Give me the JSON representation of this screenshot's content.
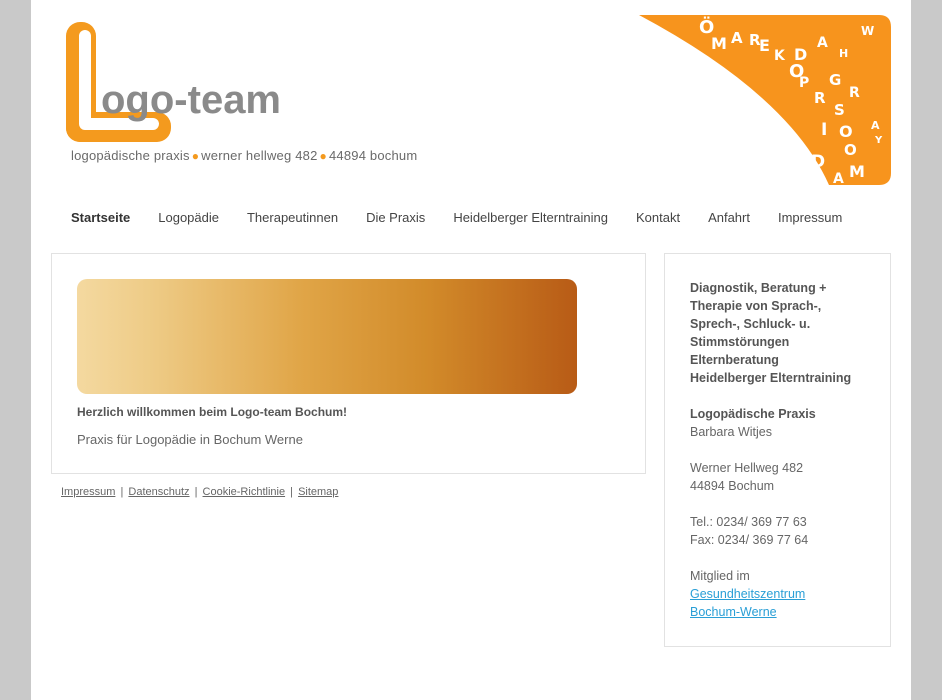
{
  "header": {
    "logo_text": "ogo-team",
    "tagline": {
      "part1": "logopädische praxis",
      "part2": "werner hellweg 482",
      "part3": "44894 bochum"
    }
  },
  "nav": {
    "items": [
      {
        "label": "Startseite",
        "active": true
      },
      {
        "label": "Logopädie"
      },
      {
        "label": "Therapeutinnen"
      },
      {
        "label": "Die Praxis"
      },
      {
        "label": "Heidelberger Elterntraining"
      },
      {
        "label": "Kontakt"
      },
      {
        "label": "Anfahrt"
      },
      {
        "label": "Impressum"
      }
    ]
  },
  "main": {
    "welcome": "Herzlich willkommen beim Logo-team Bochum!",
    "subtitle": "Praxis für Logopädie in Bochum Werne"
  },
  "footer": {
    "links": [
      "Impressum",
      "Datenschutz",
      "Cookie-Richtlinie",
      "Sitemap"
    ],
    "separator": "|"
  },
  "sidebar": {
    "services": [
      "Diagnostik, Beratung +",
      "Therapie von Sprach-,",
      "Sprech-, Schluck- u.",
      "Stimmstörungen",
      "Elternberatung",
      "Heidelberger Elterntraining"
    ],
    "practice_title": "Logopädische Praxis",
    "owner": "Barbara Witjes",
    "street": "Werner Hellweg 482",
    "city": "44894 Bochum",
    "phone": "Tel.: 0234/ 369 77 63",
    "fax": "Fax: 0234/ 369 77 64",
    "member_label": "Mitglied im",
    "member_link_line1": "Gesundheitszentrum",
    "member_link_line2": "Bochum-Werne"
  },
  "colors": {
    "brand_orange": "#f49a1e",
    "link_blue": "#2a9fd6"
  }
}
